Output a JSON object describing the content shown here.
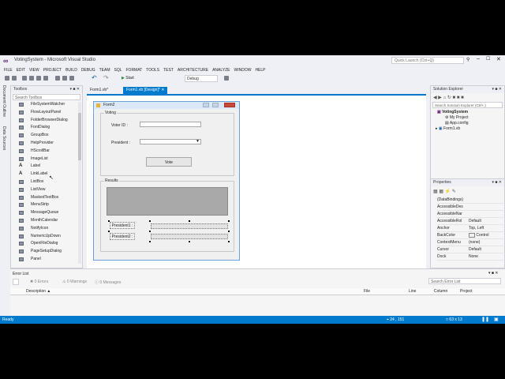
{
  "window": {
    "title": "VotingSystem - Microsoft Visual Studio",
    "quick_launch_placeholder": "Quick Launch (Ctrl+Q)"
  },
  "menu": [
    "FILE",
    "EDIT",
    "VIEW",
    "PROJECT",
    "BUILD",
    "DEBUG",
    "TEAM",
    "SQL",
    "FORMAT",
    "TOOLS",
    "TEST",
    "ARCHITECTURE",
    "ANALYZE",
    "WINDOW",
    "HELP"
  ],
  "toolbar": {
    "start_label": "Start",
    "config": "Debug"
  },
  "side_tabs": [
    "Document Outline",
    "Data Sources"
  ],
  "toolbox": {
    "title": "Toolbox",
    "search_placeholder": "Search Toolbox",
    "items": [
      "FileSystemWatcher",
      "FlowLayoutPanel",
      "FolderBrowserDialog",
      "FontDialog",
      "GroupBox",
      "HelpProvider",
      "HScrollBar",
      "ImageList",
      "Label",
      "LinkLabel",
      "ListBox",
      "ListView",
      "MaskedTextBox",
      "MenuStrip",
      "MessageQueue",
      "MonthCalendar",
      "NotifyIcon",
      "NumericUpDown",
      "OpenFileDialog",
      "PageSetupDialog",
      "Panel"
    ]
  },
  "doc_tabs": [
    "Form1.vb*",
    "Form1.vb [Design]*"
  ],
  "form": {
    "title": "Form2",
    "voting_group": "Voting",
    "voter_id_label": "Voter ID :",
    "president_label": "President :",
    "vote_button": "Vote",
    "results_group": "Results",
    "president1_label": "President1 :",
    "president2_label": "President2 :"
  },
  "solution_explorer": {
    "title": "Solution Explorer",
    "search_placeholder": "Search Solution Explorer (Ctrl+;)",
    "items": [
      "VotingSystem",
      "My Project",
      "App.config",
      "Form1.vb"
    ]
  },
  "properties": {
    "title": "Properties",
    "rows": [
      {
        "name": "(DataBindings)",
        "value": ""
      },
      {
        "name": "AccessibleDes",
        "value": ""
      },
      {
        "name": "AccessibleNar",
        "value": ""
      },
      {
        "name": "AccessibleRol",
        "value": "Default"
      },
      {
        "name": "Anchor",
        "value": "Top, Left"
      },
      {
        "name": "BackColor",
        "value": "Control"
      },
      {
        "name": "ContextMenu",
        "value": "(none)"
      },
      {
        "name": "Cursor",
        "value": "Default"
      },
      {
        "name": "Dock",
        "value": "None"
      }
    ]
  },
  "error_list": {
    "title": "Error List",
    "errors": "0 Errors",
    "warnings": "0 Warnings",
    "messages": "0 Messages",
    "search_placeholder": "Search Error List",
    "columns": [
      "Description",
      "File",
      "Line",
      "Column",
      "Project"
    ]
  },
  "status": {
    "left": "Ready",
    "position": "24 , 151",
    "size": "63 x 13"
  },
  "colors": {
    "accent": "#007acc",
    "statusbar": "#007acc",
    "chrome": "#eef0f5"
  }
}
